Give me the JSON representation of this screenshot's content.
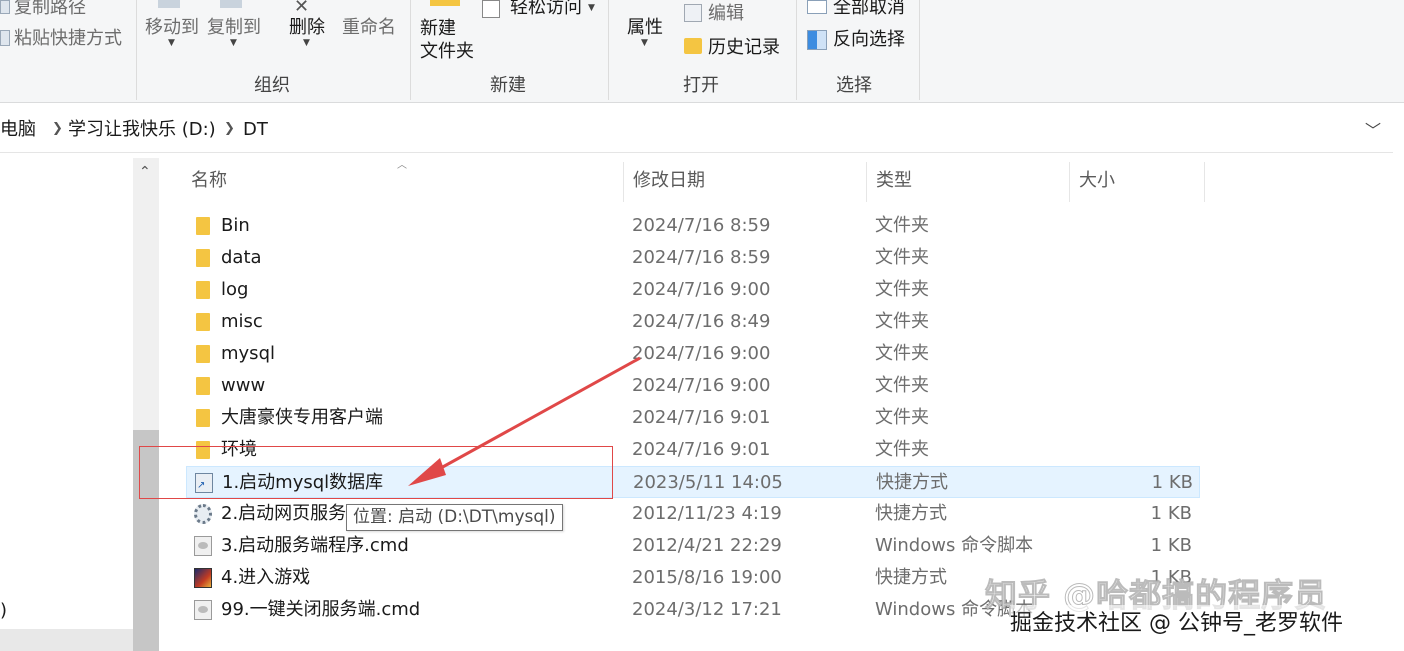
{
  "ribbon": {
    "clipboard": {
      "copy_path": "复制路径",
      "paste_shortcut": "粘贴快捷方式"
    },
    "organize": {
      "move_to": "移动到",
      "copy_to": "复制到",
      "delete": "删除",
      "rename": "重命名",
      "group_label": "组织"
    },
    "new": {
      "new_folder": "新建\n文件夹",
      "easy_access": "轻松访问",
      "group_label": "新建"
    },
    "open": {
      "properties": "属性",
      "edit": "编辑",
      "history": "历史记录",
      "group_label": "打开"
    },
    "select": {
      "select_none": "全部取消",
      "invert_selection": "反向选择",
      "group_label": "选择"
    }
  },
  "address": {
    "crumbs": [
      "电脑",
      "学习让我快乐 (D:)",
      "DT"
    ]
  },
  "nav": {
    "cut_text": ")"
  },
  "columns": {
    "name": "名称",
    "modified": "修改日期",
    "type": "类型",
    "size": "大小"
  },
  "files": [
    {
      "name": "Bin",
      "modified": "2024/7/16 8:59",
      "type": "文件夹",
      "size": "",
      "icon": "folder-icon"
    },
    {
      "name": "data",
      "modified": "2024/7/16 8:59",
      "type": "文件夹",
      "size": "",
      "icon": "folder-icon"
    },
    {
      "name": "log",
      "modified": "2024/7/16 9:00",
      "type": "文件夹",
      "size": "",
      "icon": "folder-icon"
    },
    {
      "name": "misc",
      "modified": "2024/7/16 8:49",
      "type": "文件夹",
      "size": "",
      "icon": "folder-icon"
    },
    {
      "name": "mysql",
      "modified": "2024/7/16 9:00",
      "type": "文件夹",
      "size": "",
      "icon": "folder-icon"
    },
    {
      "name": "www",
      "modified": "2024/7/16 9:00",
      "type": "文件夹",
      "size": "",
      "icon": "folder-icon"
    },
    {
      "name": "大唐豪侠专用客户端",
      "modified": "2024/7/16 9:01",
      "type": "文件夹",
      "size": "",
      "icon": "folder-icon"
    },
    {
      "name": "环境",
      "modified": "2024/7/16 9:01",
      "type": "文件夹",
      "size": "",
      "icon": "folder-icon"
    },
    {
      "name": "1.启动mysql数据库",
      "modified": "2023/5/11 14:05",
      "type": "快捷方式",
      "size": "1 KB",
      "icon": "shortcut-icon"
    },
    {
      "name": "2.启动网页服务",
      "modified": "2012/11/23 4:19",
      "type": "快捷方式",
      "size": "1 KB",
      "icon": "gear-shortcut-icon"
    },
    {
      "name": "3.启动服务端程序.cmd",
      "modified": "2012/4/21 22:29",
      "type": "Windows 命令脚本",
      "size": "1 KB",
      "icon": "cmd-script-icon"
    },
    {
      "name": "4.进入游戏",
      "modified": "2015/8/16 19:00",
      "type": "快捷方式",
      "size": "1 KB",
      "icon": "game-shortcut-icon"
    },
    {
      "name": "99.一键关闭服务端.cmd",
      "modified": "2024/3/12 17:21",
      "type": "Windows 命令脚本",
      "size": "",
      "icon": "cmd-script-icon"
    }
  ],
  "tooltip": "位置: 启动 (D:\\DT\\mysql)",
  "watermarks": {
    "zhihu": "知乎 @哈都搞的程序员",
    "juejin": "掘金技术社区 @ 公钟号_老罗软件"
  },
  "colors": {
    "selected_row": "#e5f3ff",
    "annotation_red": "#e04848",
    "folder_yellow": "#f4c542"
  }
}
